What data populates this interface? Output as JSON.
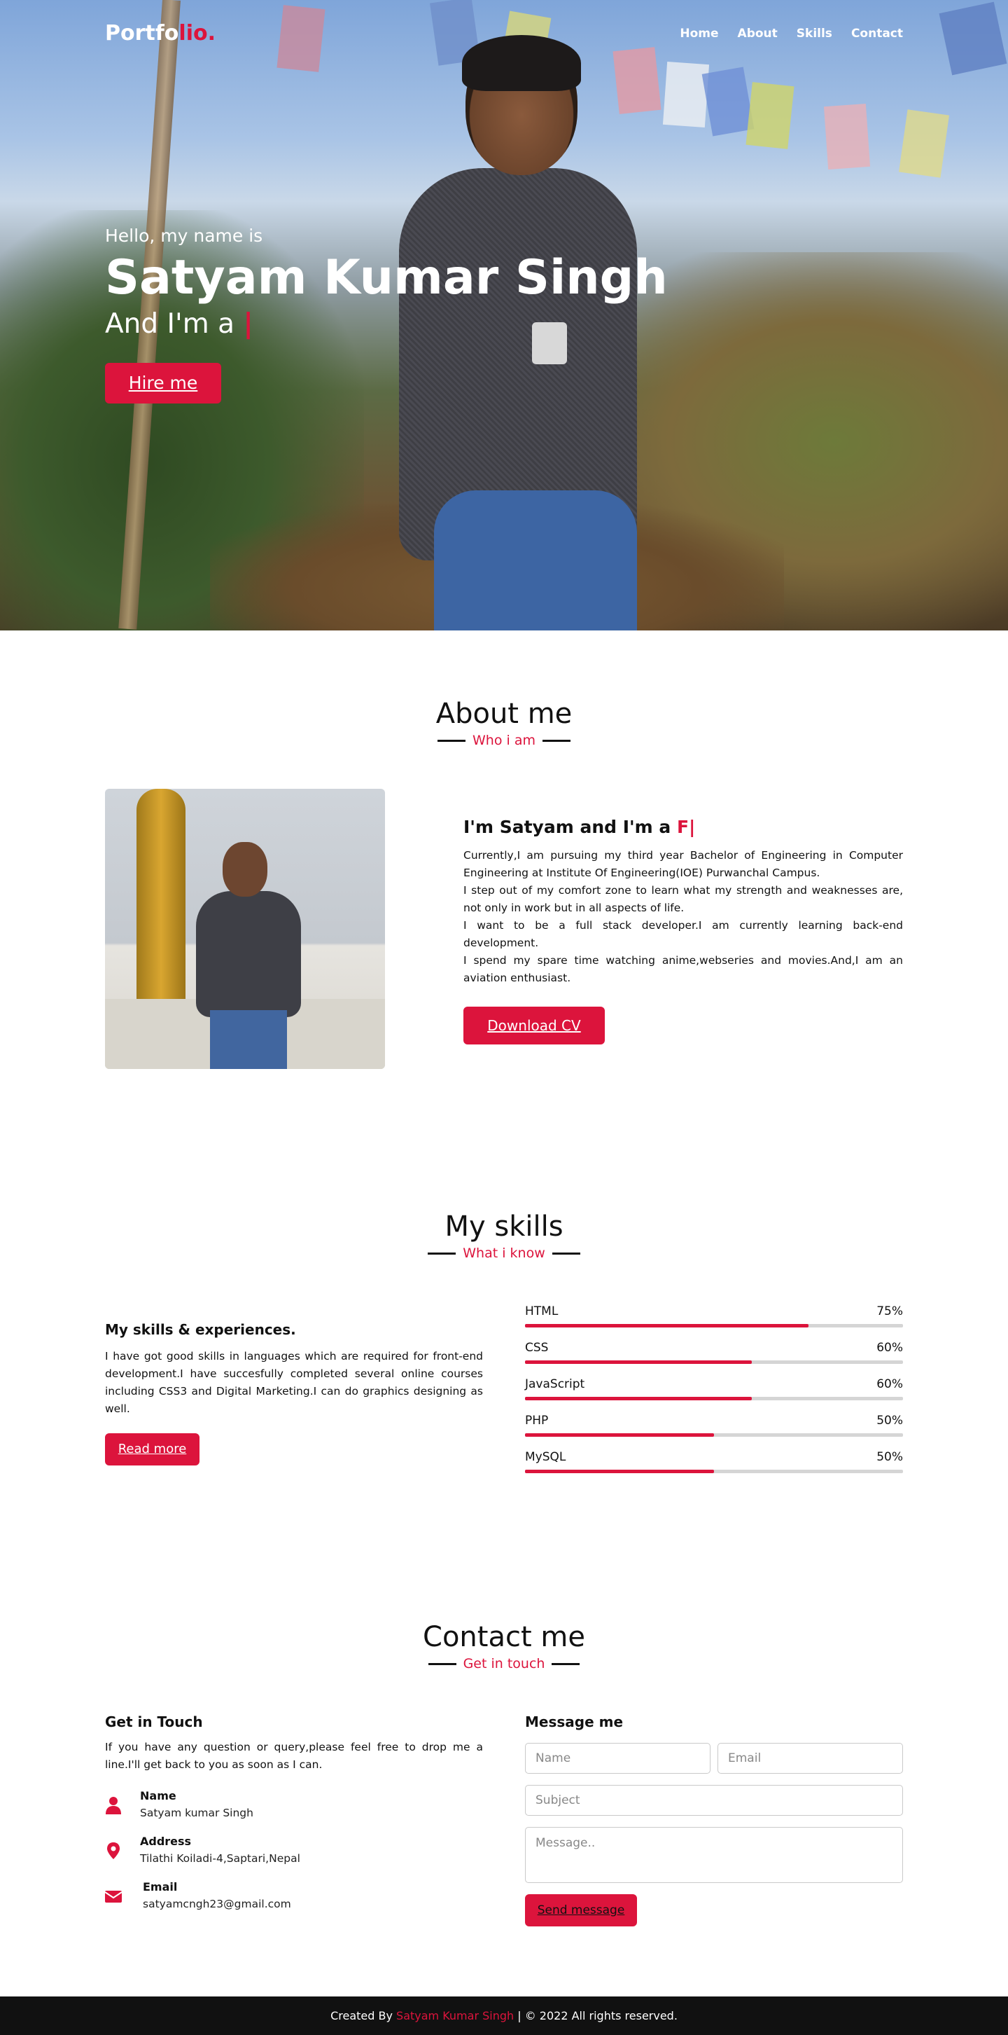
{
  "colors": {
    "accent": "#dc143c",
    "dark": "#111111",
    "footer_bg": "#111111"
  },
  "nav": {
    "logo_main": "Portfo",
    "logo_accent": "lio.",
    "items": [
      {
        "label": "Home"
      },
      {
        "label": "About"
      },
      {
        "label": "Skills"
      },
      {
        "label": "Contact"
      }
    ]
  },
  "hero": {
    "greeting": "Hello, my name is",
    "name": "Satyam Kumar Singh",
    "role_prefix": "And I'm a",
    "caret": "|",
    "hire_label": "Hire me"
  },
  "about": {
    "title": "About me",
    "subtitle": "Who i am",
    "heading_prefix": "I'm Satyam and I'm a",
    "heading_typed": "F|",
    "paragraphs": [
      "Currently,I am pursuing my third year Bachelor of Engineering in Computer Engineering at Institute Of Engineering(IOE) Purwanchal Campus.",
      "I step out of my comfort zone to learn what my strength and weaknesses are, not only in work but in all aspects of life.",
      "I want to be a full stack developer.I am currently learning back-end development.",
      "I spend my spare time watching anime,webseries and movies.And,I am an aviation enthusiast."
    ],
    "cv_label": "Download CV"
  },
  "skills": {
    "title": "My skills",
    "subtitle": "What i know",
    "heading": "My skills & experiences.",
    "text": "I have got good skills in languages which are required for front-end development.I have succesfully completed several online courses including CSS3 and Digital Marketing.I can do graphics designing as well.",
    "readmore_label": "Read more",
    "bars": [
      {
        "name": "HTML",
        "percent_label": "75%",
        "value": 75
      },
      {
        "name": "CSS",
        "percent_label": "60%",
        "value": 60
      },
      {
        "name": "JavaScript",
        "percent_label": "60%",
        "value": 60
      },
      {
        "name": "PHP",
        "percent_label": "50%",
        "value": 50
      },
      {
        "name": "MySQL",
        "percent_label": "50%",
        "value": 50
      }
    ]
  },
  "contact": {
    "title": "Contact me",
    "subtitle": "Get in touch",
    "left_heading": "Get in Touch",
    "left_text": "If you have any question or query,please feel free to drop me a line.I'll get back to you as soon as I can.",
    "info": [
      {
        "icon": "user-icon",
        "title": "Name",
        "value": "Satyam kumar Singh"
      },
      {
        "icon": "map-marker-icon",
        "title": "Address",
        "value": "Tilathi Koiladi-4,Saptari,Nepal"
      },
      {
        "icon": "envelope-icon",
        "title": "Email",
        "value": "satyamcngh23@gmail.com"
      }
    ],
    "form_heading": "Message me",
    "name_placeholder": "Name",
    "email_placeholder": "Email",
    "subject_placeholder": "Subject",
    "message_placeholder": "Message..",
    "send_label": "Send message"
  },
  "footer": {
    "prefix": "Created By",
    "author": "Satyam Kumar Singh",
    "suffix": "| © 2022 All rights reserved."
  }
}
